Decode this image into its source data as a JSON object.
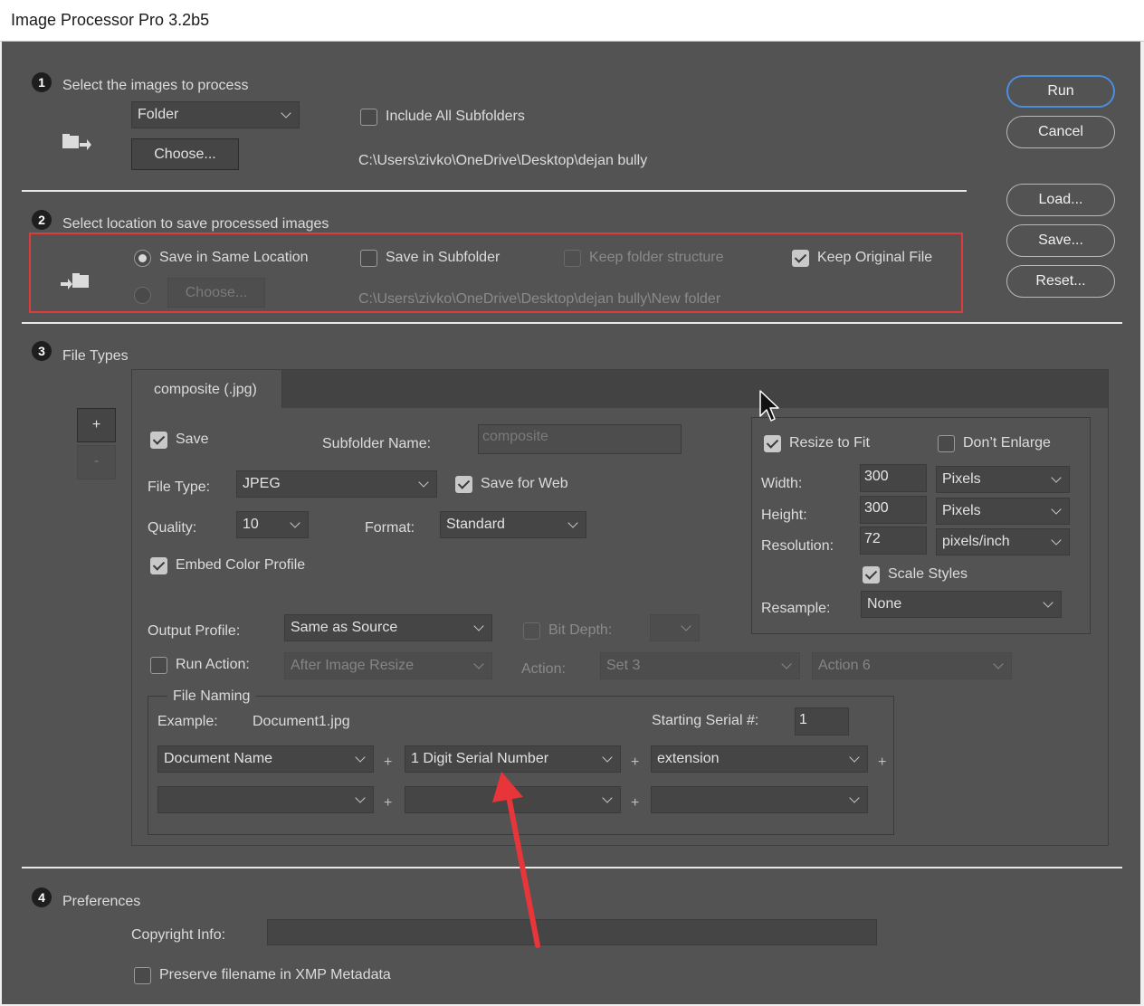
{
  "window": {
    "title": "Image Processor Pro 3.2b5"
  },
  "side_buttons": {
    "run": "Run",
    "cancel": "Cancel",
    "load": "Load...",
    "save": "Save...",
    "reset": "Reset..."
  },
  "section1": {
    "number": "1",
    "title": "Select the images to process",
    "source_select": "Folder",
    "choose_label": "Choose...",
    "include_subfolders_label": "Include All Subfolders",
    "include_subfolders_checked": false,
    "path": "C:\\Users\\zivko\\OneDrive\\Desktop\\dejan bully"
  },
  "section2": {
    "number": "2",
    "title": "Select location to save processed images",
    "save_same_label": "Save in Same Location",
    "save_subfolder_label": "Save in Subfolder",
    "keep_structure_label": "Keep folder structure",
    "keep_original_label": "Keep Original File",
    "choose_label": "Choose...",
    "path": "C:\\Users\\zivko\\OneDrive\\Desktop\\dejan bully\\New folder"
  },
  "section3": {
    "number": "3",
    "title": "File Types",
    "add_label": "+",
    "remove_label": "-",
    "tab_label": "composite (.jpg)",
    "save_label": "Save",
    "subfolder_name_label": "Subfolder Name:",
    "subfolder_name_value": "composite",
    "file_type_label": "File Type:",
    "file_type_value": "JPEG",
    "save_for_web_label": "Save for Web",
    "quality_label": "Quality:",
    "quality_value": "10",
    "format_label": "Format:",
    "format_value": "Standard",
    "embed_profile_label": "Embed Color Profile",
    "output_profile_label": "Output Profile:",
    "output_profile_value": "Same as Source",
    "bit_depth_label": "Bit Depth:",
    "run_action_label": "Run Action:",
    "run_action_value": "After Image Resize",
    "action_label": "Action:",
    "action_set_value": "Set 3",
    "action_value": "Action 6",
    "resize": {
      "resize_to_fit_label": "Resize to Fit",
      "dont_enlarge_label": "Don’t Enlarge",
      "width_label": "Width:",
      "width_value": "300",
      "width_unit": "Pixels",
      "height_label": "Height:",
      "height_value": "300",
      "height_unit": "Pixels",
      "resolution_label": "Resolution:",
      "resolution_value": "72",
      "resolution_unit": "pixels/inch",
      "scale_styles_label": "Scale Styles",
      "resample_label": "Resample:",
      "resample_value": "None"
    },
    "naming": {
      "title": "File Naming",
      "example_label": "Example:",
      "example_value": "Document1.jpg",
      "serial_label": "Starting Serial #:",
      "serial_value": "1",
      "field1": "Document Name",
      "field2": "1 Digit Serial Number",
      "field3": "extension",
      "plus": "+"
    }
  },
  "section4": {
    "number": "4",
    "title": "Preferences",
    "copyright_label": "Copyright Info:",
    "preserve_label": "Preserve filename in XMP Metadata"
  },
  "colors": {
    "dialog_bg": "#535353",
    "highlight_box": "#e03a3a",
    "arrow": "#e8353a",
    "primary_button_border": "#4a8ddc"
  }
}
